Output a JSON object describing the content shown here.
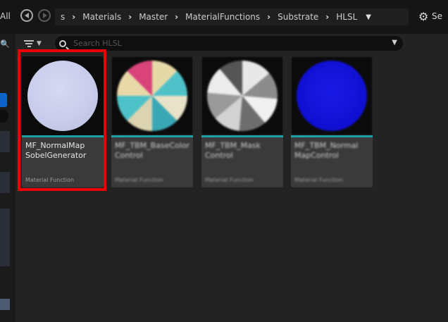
{
  "topbar": {
    "all_label": "All",
    "settings_label": "Se",
    "breadcrumb": [
      "s",
      "Materials",
      "Master",
      "MaterialFunctions",
      "Substrate",
      "HLSL"
    ]
  },
  "search": {
    "placeholder": "Search HLSL"
  },
  "assets": [
    {
      "name_line1": "MF_NormalMap",
      "name_line2": "SobelGenerator",
      "type": "Material Function",
      "selected": true
    },
    {
      "name_line1": "MF_TBM_BaseColor",
      "name_line2": "Control",
      "type": "Material Function",
      "selected": false
    },
    {
      "name_line1": "MF_TBM_Mask",
      "name_line2": "Control",
      "type": "Material Function",
      "selected": false
    },
    {
      "name_line1": "MF_TBM_Normal",
      "name_line2": "MapControl",
      "type": "Material Function",
      "selected": false
    }
  ],
  "colors": {
    "accent": "#1fa0a6",
    "highlight": "#ee0000",
    "left_panel_selected": "#0d63c9"
  }
}
